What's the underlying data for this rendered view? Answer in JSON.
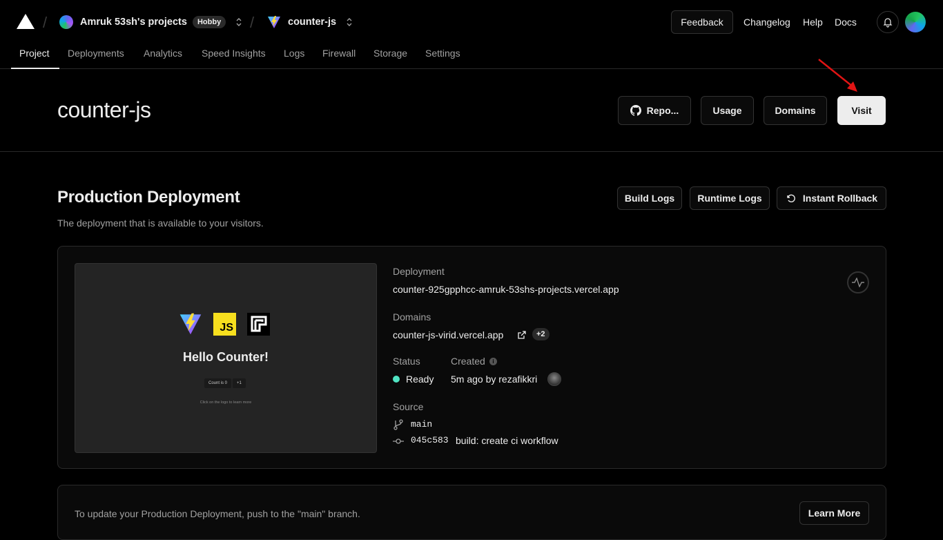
{
  "header": {
    "team_name": "Amruk 53sh's projects",
    "plan_badge": "Hobby",
    "project_name": "counter-js",
    "feedback_label": "Feedback",
    "links": [
      "Changelog",
      "Help",
      "Docs"
    ]
  },
  "tabs": [
    {
      "label": "Project",
      "active": true
    },
    {
      "label": "Deployments"
    },
    {
      "label": "Analytics"
    },
    {
      "label": "Speed Insights"
    },
    {
      "label": "Logs"
    },
    {
      "label": "Firewall"
    },
    {
      "label": "Storage"
    },
    {
      "label": "Settings"
    }
  ],
  "project": {
    "title": "counter-js",
    "repo_label": "Repo...",
    "usage_label": "Usage",
    "domains_label": "Domains",
    "visit_label": "Visit"
  },
  "production": {
    "title": "Production Deployment",
    "subtitle": "The deployment that is available to your visitors.",
    "build_logs_label": "Build Logs",
    "runtime_logs_label": "Runtime Logs",
    "rollback_label": "Instant Rollback",
    "preview": {
      "title": "Hello Counter!",
      "count_label": "Count is 0",
      "plus_label": "+1",
      "hint": "Click on the logo to learn more",
      "js_label": "JS"
    },
    "deployment_label": "Deployment",
    "deployment_url": "counter-925gpphcc-amruk-53shs-projects.vercel.app",
    "domains_label": "Domains",
    "domain": "counter-js-virid.vercel.app",
    "domain_extra": "+2",
    "status_label": "Status",
    "status_value": "Ready",
    "status_color": "#50e3c2",
    "created_label": "Created",
    "created_value": "5m ago by rezafikkri",
    "source_label": "Source",
    "branch": "main",
    "commit_hash": "045c583",
    "commit_message": "build: create ci workflow"
  },
  "update_notice": {
    "text": "To update your Production Deployment, push to the \"main\" branch.",
    "learn_more_label": "Learn More"
  },
  "colors": {
    "background": "#000000",
    "visit_button": "#ededed",
    "annotation_arrow": "#e01414"
  }
}
